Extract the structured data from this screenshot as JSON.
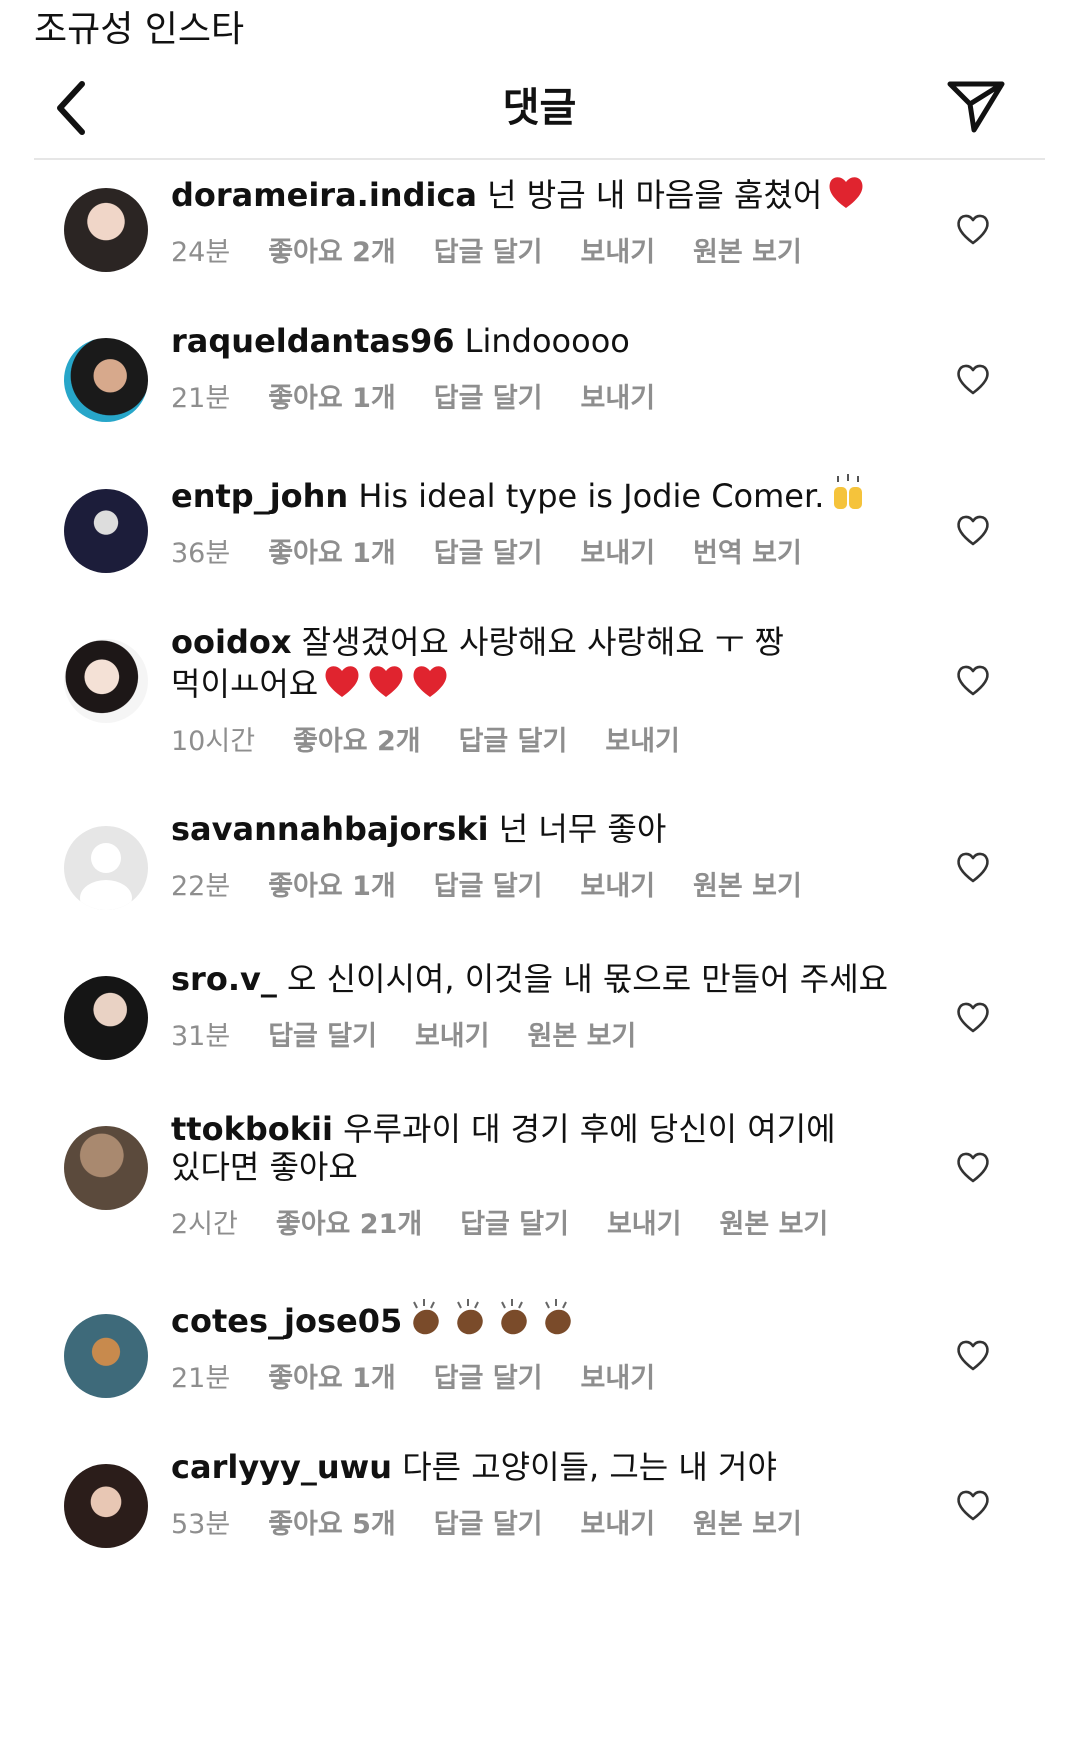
{
  "caption": "조규성 인스타",
  "header": {
    "title": "댓글"
  },
  "comments": [
    {
      "user": "dorameira.indica",
      "text": "넌 방금 내 마음을 훔쳤어",
      "emoji": "heart",
      "emoji_count": 1,
      "time": "24분",
      "likes": "좋아요 2개",
      "reply": "답글 달기",
      "send": "보내기",
      "extra": "원본 보기"
    },
    {
      "user": "raqueldantas96",
      "text": "Lindooooo",
      "emoji": "",
      "emoji_count": 0,
      "time": "21분",
      "likes": "좋아요 1개",
      "reply": "답글 달기",
      "send": "보내기",
      "extra": ""
    },
    {
      "user": "entp_john",
      "text": "His ideal type is Jodie Comer.",
      "emoji": "raised-hands",
      "emoji_count": 1,
      "time": "36분",
      "likes": "좋아요 1개",
      "reply": "답글 달기",
      "send": "보내기",
      "extra": "번역 보기"
    },
    {
      "user": "ooidox",
      "text": "잘생겼어요 사랑해요 사랑해요 ㅜ 짱 먹이ㅛ어요",
      "emoji": "heart",
      "emoji_count": 3,
      "time": "10시간",
      "likes": "좋아요 2개",
      "reply": "답글 달기",
      "send": "보내기",
      "extra": ""
    },
    {
      "user": "savannahbajorski",
      "text": "넌 너무 좋아",
      "emoji": "",
      "emoji_count": 0,
      "time": "22분",
      "likes": "좋아요 1개",
      "reply": "답글 달기",
      "send": "보내기",
      "extra": "원본 보기"
    },
    {
      "user": "sro.v_",
      "text": "오 신이시여, 이것을 내 몫으로 만들어 주세요",
      "emoji": "",
      "emoji_count": 0,
      "time": "31분",
      "likes": "",
      "reply": "답글 달기",
      "send": "보내기",
      "extra": "원본 보기"
    },
    {
      "user": "ttokbokii",
      "text": "우루과이 대 경기 후에 당신이 여기에 있다면 좋아요",
      "emoji": "",
      "emoji_count": 0,
      "time": "2시간",
      "likes": "좋아요 21개",
      "reply": "답글 달기",
      "send": "보내기",
      "extra": "원본 보기"
    },
    {
      "user": "cotes_jose05",
      "text": "",
      "emoji": "clapping-hands",
      "emoji_count": 4,
      "time": "21분",
      "likes": "좋아요 1개",
      "reply": "답글 달기",
      "send": "보내기",
      "extra": ""
    },
    {
      "user": "carlyyy_uwu",
      "text": "다른 고양이들, 그는 내 거야",
      "emoji": "",
      "emoji_count": 0,
      "time": "53분",
      "likes": "좋아요 5개",
      "reply": "답글 달기",
      "send": "보내기",
      "extra": "원본 보기"
    }
  ],
  "icons": {
    "back": "chevron-left-icon",
    "send": "paper-plane-icon",
    "like": "heart-outline-icon"
  },
  "colors": {
    "meta": "#8e8e8e",
    "heart_emoji": "#e0242f",
    "divider": "#e6e6e6"
  }
}
